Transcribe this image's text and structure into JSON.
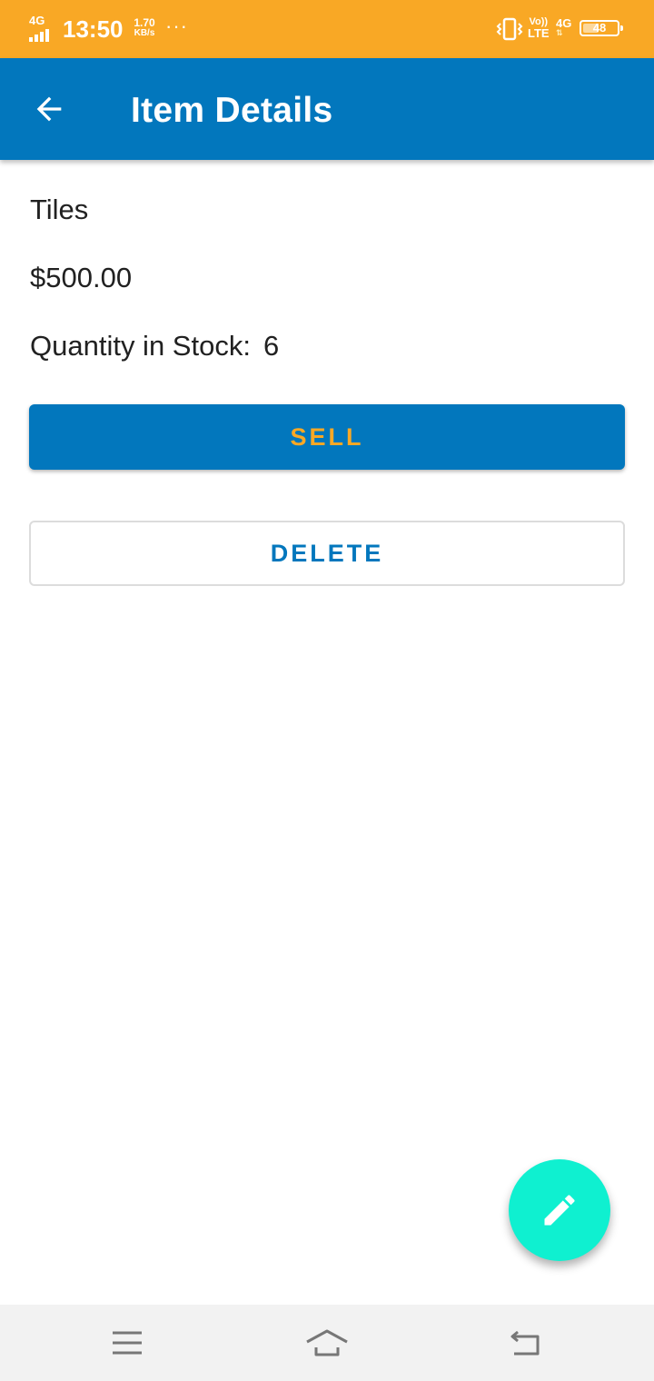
{
  "status_bar": {
    "network_label": "4G",
    "time": "13:50",
    "speed_value": "1.70",
    "speed_unit": "KB/s",
    "more_indicator": "···",
    "volte_top": "Vo))",
    "volte_bottom": "LTE",
    "mobile_data": "4G",
    "battery_level": "48",
    "battery_fraction": 0.48,
    "background_color": "#f9a825",
    "icons": [
      "signal-icon",
      "vibrate-icon",
      "battery-icon"
    ]
  },
  "app_bar": {
    "title": "Item Details",
    "background_color": "#0277bd",
    "back_icon": "arrow-back-icon"
  },
  "item": {
    "name": "Tiles",
    "price": "$500.00",
    "quantity_label": "Quantity in Stock:",
    "quantity_value": "6"
  },
  "actions": {
    "sell_label": "SELL",
    "delete_label": "DELETE",
    "sell_text_color": "#f9a825",
    "primary_color": "#0277bd"
  },
  "fab": {
    "icon": "edit-pencil-icon",
    "color": "#0ff0d0"
  },
  "nav_bar": {
    "icons": [
      "menu-icon",
      "home-icon",
      "back-icon"
    ]
  }
}
